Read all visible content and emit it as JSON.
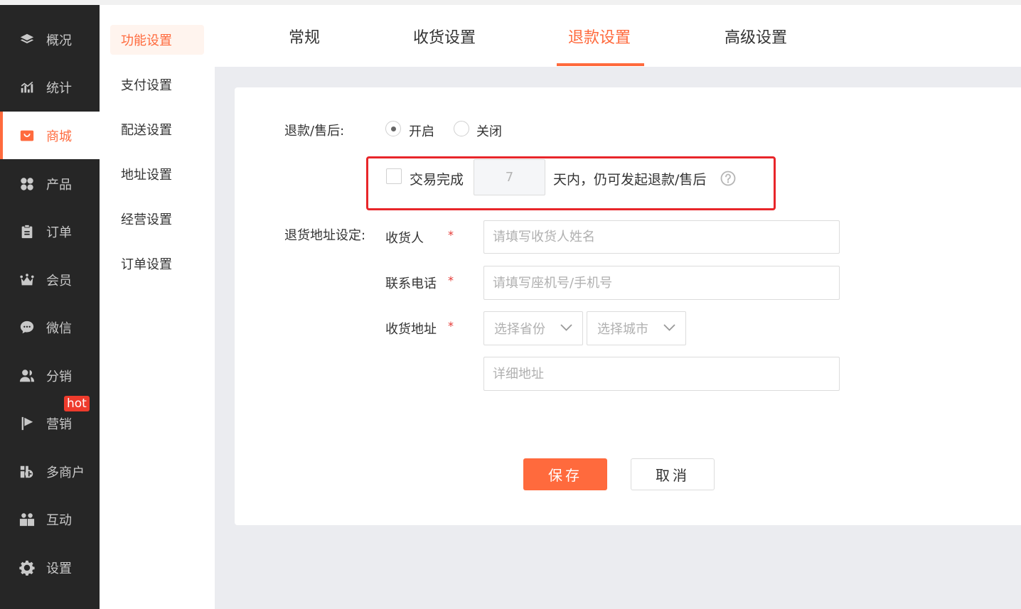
{
  "sidebar": {
    "items": [
      {
        "label": "概况",
        "icon": "layers-icon"
      },
      {
        "label": "统计",
        "icon": "chart-icon"
      },
      {
        "label": "商城",
        "icon": "shop-icon"
      },
      {
        "label": "产品",
        "icon": "grid-icon"
      },
      {
        "label": "订单",
        "icon": "clipboard-icon"
      },
      {
        "label": "会员",
        "icon": "crown-icon"
      },
      {
        "label": "微信",
        "icon": "wechat-icon"
      },
      {
        "label": "分销",
        "icon": "users-icon"
      },
      {
        "label": "营销",
        "icon": "flag-icon"
      },
      {
        "label": "多商户",
        "icon": "store-plus-icon"
      },
      {
        "label": "互动",
        "icon": "group-icon"
      },
      {
        "label": "设置",
        "icon": "gear-icon"
      }
    ],
    "active_index": 2,
    "hot_badge": "hot"
  },
  "subnav": {
    "items": [
      "功能设置",
      "支付设置",
      "配送设置",
      "地址设置",
      "经营设置",
      "订单设置"
    ],
    "active_index": 0
  },
  "tabs": {
    "items": [
      "常规",
      "收货设置",
      "退款设置",
      "高级设置"
    ],
    "active_index": 2
  },
  "form": {
    "refund_label": "退款/售后:",
    "radio_on": "开启",
    "radio_off": "关闭",
    "selected": "开启",
    "trade_complete_label": "交易完成",
    "days_placeholder": "7",
    "days_suffix": "天内，仍可发起退款/售后",
    "return_address_label": "退货地址设定:",
    "receiver_label": "收货人",
    "receiver_placeholder": "请填写收货人姓名",
    "phone_label": "联系电话",
    "phone_placeholder": "请填写座机号/手机号",
    "address_label": "收货地址",
    "province_placeholder": "选择省份",
    "city_placeholder": "选择城市",
    "detail_placeholder": "详细地址",
    "required_mark": "*",
    "save_label": "保存",
    "cancel_label": "取消"
  },
  "colors": {
    "accent": "#ff6a3d",
    "sidebar_bg": "#262626",
    "highlight": "#e8262a",
    "required": "#e53935"
  }
}
